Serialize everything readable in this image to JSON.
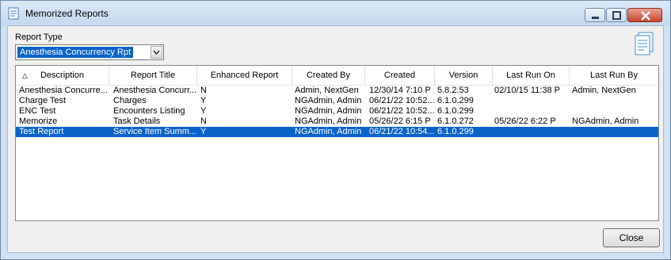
{
  "window": {
    "title": "Memorized Reports"
  },
  "report_type": {
    "label": "Report Type",
    "selected": "Anesthesia Concurrency Rpt"
  },
  "table": {
    "columns": [
      "Description",
      "Report Title",
      "Enhanced Report",
      "Created By",
      "Created",
      "Version",
      "Last Run On",
      "Last Run By"
    ],
    "sort_column": "Description",
    "rows": [
      [
        "Anesthesia Concurre...",
        "Anesthesia Concurr...",
        "N",
        "Admin, NextGen",
        "12/30/14 7:10 P",
        "5.8.2.53",
        "02/10/15 11:38 P",
        "Admin, NextGen"
      ],
      [
        "Charge Test",
        "Charges",
        "Y",
        "NGAdmin, Admin",
        "06/21/22 10:52...",
        "6.1.0.299",
        "",
        ""
      ],
      [
        "ENC Test",
        "Encounters Listing",
        "Y",
        "NGAdmin, Admin",
        "06/21/22 10:52...",
        "6.1.0.299",
        "",
        ""
      ],
      [
        "Memorize",
        "Task Details",
        "N",
        "NGAdmin, Admin",
        "05/26/22 6:15 P",
        "6.1.0.272",
        "05/26/22 6:22 P",
        "NGAdmin, Admin"
      ],
      [
        "Test Report",
        "Service Item Summ...",
        "Y",
        "NGAdmin, Admin",
        "06/21/22 10:54...",
        "6.1.0.299",
        "",
        ""
      ]
    ],
    "selected_row": 4
  },
  "buttons": {
    "close": "Close"
  },
  "colors": {
    "selection": "#0a63c9",
    "title_bar": "#cfe0f2",
    "close_control": "#c74530"
  }
}
